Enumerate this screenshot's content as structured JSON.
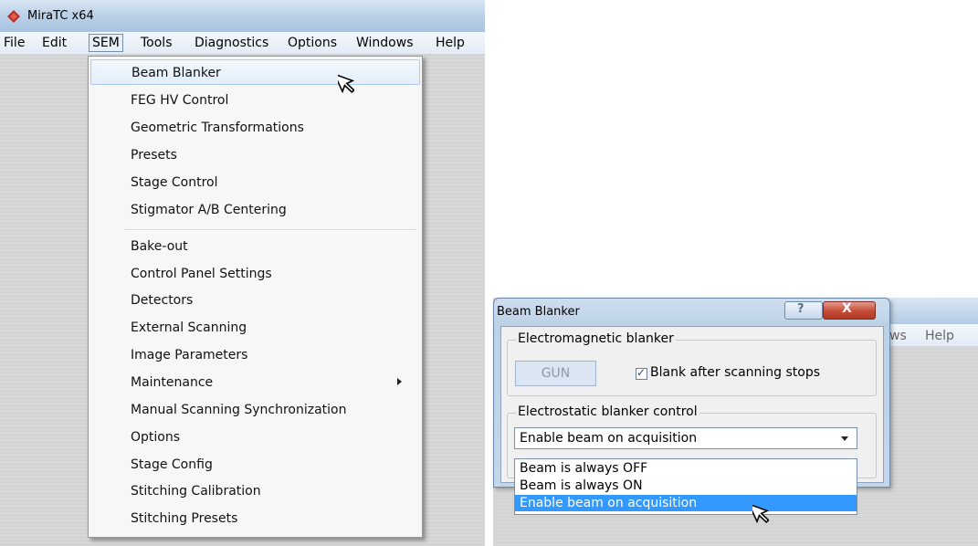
{
  "app": {
    "title": "MiraTC x64"
  },
  "menubar": {
    "items": [
      {
        "label": "File"
      },
      {
        "label": "Edit"
      },
      {
        "label": "SEM"
      },
      {
        "label": "Tools"
      },
      {
        "label": "Diagnostics"
      },
      {
        "label": "Options"
      },
      {
        "label": "Windows"
      },
      {
        "label": "Help"
      }
    ],
    "active": "SEM"
  },
  "sem_menu": {
    "items": [
      {
        "label": "Beam Blanker",
        "highlighted": true
      },
      {
        "label": "FEG HV Control"
      },
      {
        "label": "Geometric Transformations"
      },
      {
        "label": "Presets"
      },
      {
        "label": "Stage Control"
      },
      {
        "label": "Stigmator A/B Centering"
      },
      {
        "label": "Bake-out"
      },
      {
        "label": "Control Panel Settings"
      },
      {
        "label": "Detectors"
      },
      {
        "label": "External Scanning"
      },
      {
        "label": "Image Parameters"
      },
      {
        "label": "Maintenance",
        "submenu": true
      },
      {
        "label": "Manual Scanning Synchronization"
      },
      {
        "label": "Options"
      },
      {
        "label": "Stage Config"
      },
      {
        "label": "Stitching Calibration"
      },
      {
        "label": "Stitching Presets"
      }
    ]
  },
  "background_menubar": {
    "items": [
      {
        "label": "ws"
      },
      {
        "label": "Help"
      }
    ]
  },
  "dialog": {
    "title": "Beam Blanker",
    "help_label": "?",
    "close_label": "X",
    "em_group": {
      "legend": "Electromagnetic blanker",
      "gun_label": "GUN",
      "checkbox_label": "Blank after scanning stops",
      "checkbox_checked": true,
      "checkbox_mark": "✓"
    },
    "es_group": {
      "legend": "Electrostatic blanker control",
      "selected": "Enable beam on acquisition",
      "options": [
        {
          "label": "Beam is always OFF"
        },
        {
          "label": "Beam is always ON"
        },
        {
          "label": "Enable beam on acquisition",
          "selected": true
        }
      ]
    }
  },
  "colors": {
    "selection": "#3399ff",
    "close_button": "#c44a36",
    "titlebar": "#bcd2e8"
  }
}
